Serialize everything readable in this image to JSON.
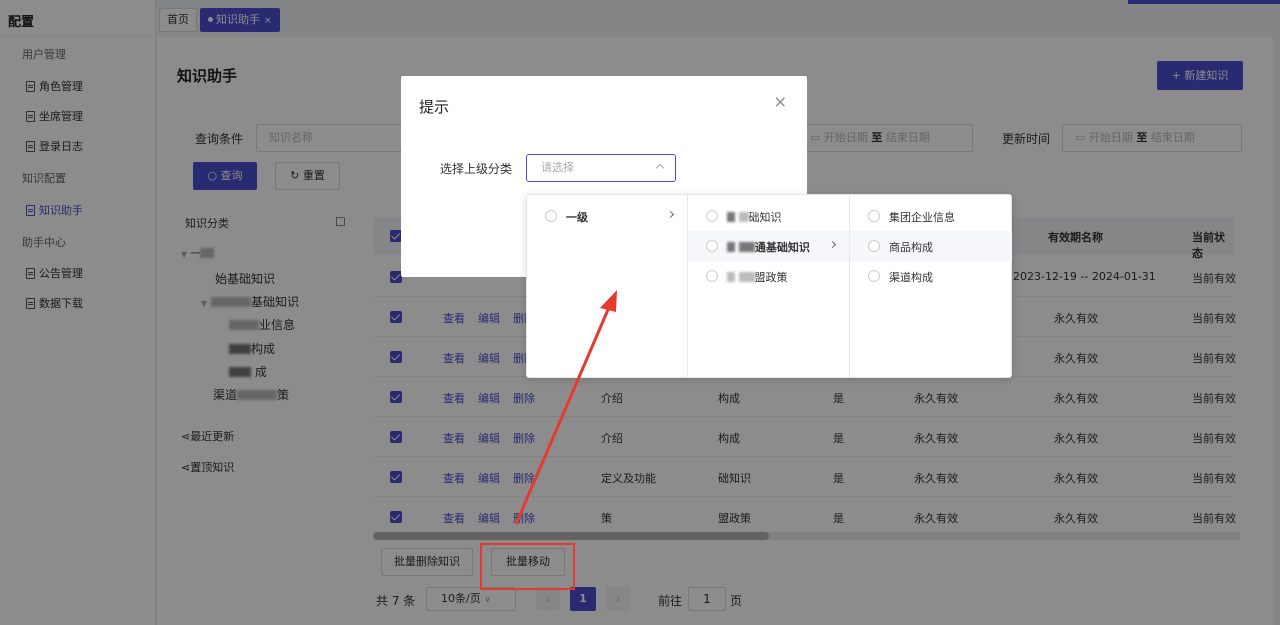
{
  "sidebar": {
    "title": "配置",
    "groups": [
      {
        "label": "用户管理",
        "items": [
          {
            "label": "角色管理"
          },
          {
            "label": "坐席管理"
          },
          {
            "label": "登录日志"
          }
        ]
      },
      {
        "label": "知识配置",
        "items": [
          {
            "label": "知识助手"
          }
        ]
      },
      {
        "label": "助手中心",
        "items": [
          {
            "label": "公告管理"
          },
          {
            "label": "数据下载"
          }
        ]
      }
    ]
  },
  "tabs": [
    {
      "label": "首页"
    },
    {
      "label": "知识助手",
      "close": "×"
    }
  ],
  "main": {
    "title": "知识助手",
    "new_button": "+ 新建知识",
    "filters": {
      "label": "查询条件",
      "name_placeholder": "知识名称",
      "date_label_2": "更新时间",
      "start_placeholder": "开始日期",
      "to": "至",
      "end_placeholder": "结束日期"
    },
    "query_button": "查询",
    "reset_button": "重置"
  },
  "tree": {
    "title": "知识分类",
    "nodes": [
      {
        "text": "一"
      },
      {
        "text": "始基础知识"
      },
      {
        "text": "基础知识"
      },
      {
        "text": "业信息"
      },
      {
        "text": "构成"
      },
      {
        "text": "成"
      },
      {
        "text": "渠道"
      },
      {
        "text": "策"
      }
    ],
    "recent": "最近更新",
    "pinned": "置顶知识"
  },
  "table": {
    "headers": {
      "validity_name": "有效期名称",
      "status": "当前状态"
    },
    "ops": {
      "view": "查看",
      "edit": "编辑",
      "delete": "删除"
    },
    "rows": [
      {
        "validity": "2023-12-19 -- 2024-01-31",
        "status": "当前有效"
      },
      {
        "validity": "永久有效",
        "status": "当前有效"
      },
      {
        "validity": "永久有效",
        "status": "当前有效"
      },
      {
        "c1": "介绍",
        "c2": "构成",
        "c3": "是",
        "c4": "永久有效",
        "validity": "永久有效",
        "status": "当前有效"
      },
      {
        "c1": "介绍",
        "c2": "构成",
        "c3": "是",
        "c4": "永久有效",
        "validity": "永久有效",
        "status": "当前有效"
      },
      {
        "c1": "定义及功能",
        "c2": "础知识",
        "c3": "是",
        "c4": "永久有效",
        "validity": "永久有效",
        "status": "当前有效"
      },
      {
        "c1": "策",
        "c2": "盟政策",
        "c3": "是",
        "c4": "永久有效",
        "validity": "永久有效",
        "status": "当前有效"
      }
    ]
  },
  "bottom": {
    "batch_delete": "批量删除知识",
    "batch_move": "批量移动",
    "total": "共 7 条",
    "page_size": "10条/页",
    "current_page": "1",
    "goto": "前往",
    "goto_value": "1",
    "page_unit": "页"
  },
  "dialog": {
    "title": "提示",
    "close": "×",
    "field_label": "选择上级分类",
    "select_placeholder": "请选择"
  },
  "cascader": {
    "col1": [
      {
        "label": "一级"
      }
    ],
    "col2": [
      {
        "label": "础知识"
      },
      {
        "label": "通基础知识"
      },
      {
        "label": "盟政策"
      }
    ],
    "col3": [
      {
        "label": "集团企业信息"
      },
      {
        "label": "商品构成"
      },
      {
        "label": "渠道构成"
      }
    ]
  },
  "colors": {
    "accent": "#4b4dcf",
    "annotation": "#e53a2f"
  }
}
